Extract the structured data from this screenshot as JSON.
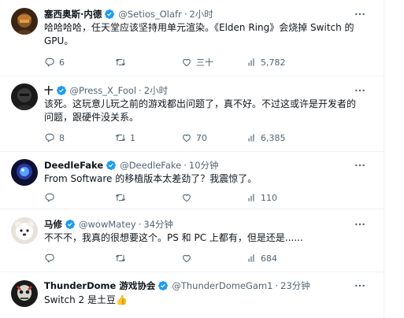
{
  "tweets": [
    {
      "name": "塞西奥斯·内德",
      "handle": "@Setios_Olafr",
      "time": "2小时",
      "text": "哈哈哈哈，任天堂应该坚持用单元渲染。《Elden Ring》会烧掉 Switch 的 GPU。",
      "replies": "6",
      "retweets": "",
      "likes": "三十",
      "views": "5,782"
    },
    {
      "name": "十",
      "handle": "@Press_X_Fool",
      "time": "2小时",
      "text": "该死。这玩意儿玩之前的游戏都出问题了，真不好。不过这或许是开发者的问题，跟硬件没关系。",
      "replies": "8",
      "retweets": "1",
      "likes": "70",
      "views": "6,385"
    },
    {
      "name": "DeedleFake",
      "handle": "@DeedleFake",
      "time": "10分钟",
      "text": "From Software 的移植版本太差劲了？我震惊了。",
      "replies": "",
      "retweets": "",
      "likes": "",
      "views": "110"
    },
    {
      "name": "马修",
      "handle": "@wowMatey",
      "time": "34分钟",
      "text": "不不不，我真的很想要这个。PS 和 PC 上都有，但是还是......",
      "replies": "",
      "retweets": "",
      "likes": "",
      "views": "684"
    },
    {
      "name": "ThunderDome 游戏协会",
      "handle": "@ThunderDomeGam1",
      "time": "23分钟",
      "text": "Switch 2 是土豆👍",
      "replies": "",
      "retweets": "",
      "likes": "",
      "views": ""
    }
  ],
  "colors": {
    "verified_badge": "#1d9bf0",
    "secondary_text": "#536471",
    "divider": "#eff3f4"
  },
  "icons": [
    "verified-badge-icon",
    "more-icon",
    "reply-icon",
    "retweet-icon",
    "like-icon",
    "views-icon"
  ]
}
